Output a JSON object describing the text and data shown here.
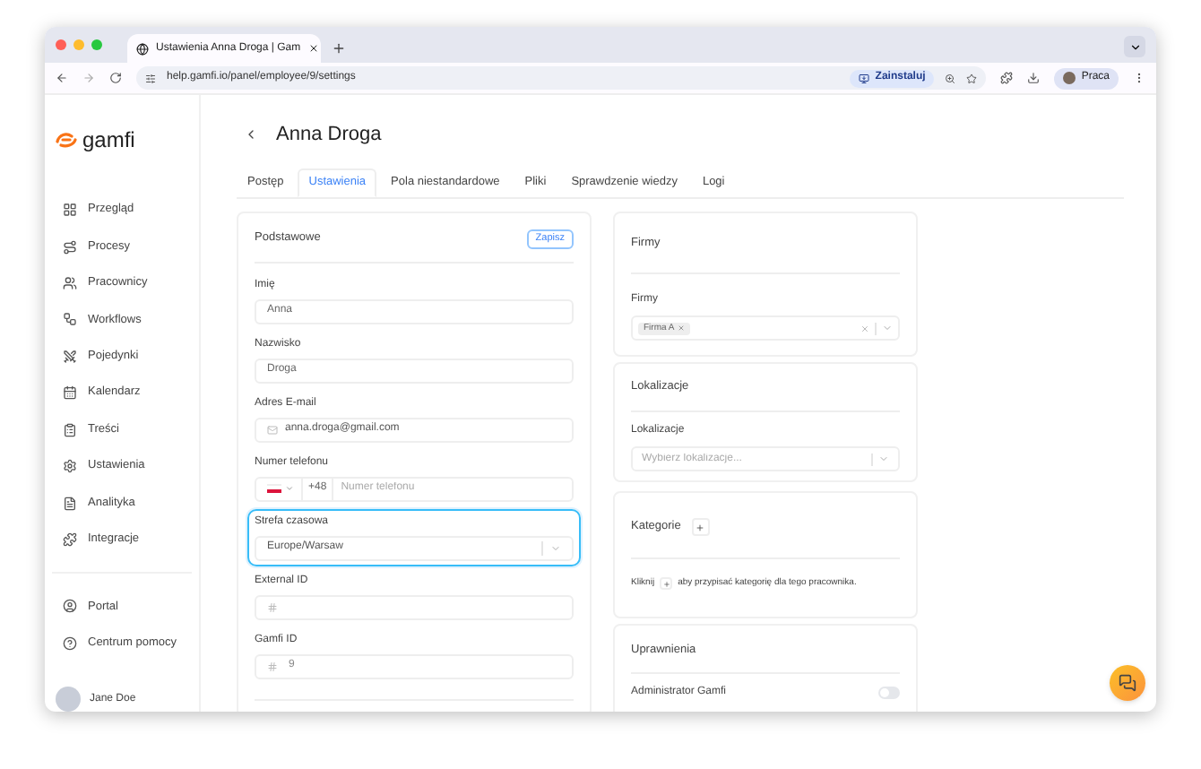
{
  "browser": {
    "tab_title": "Ustawienia Anna Droga | Gam",
    "url": "help.gamfi.io/panel/employee/9/settings",
    "install_label": "Zainstaluj",
    "profile_label": "Praca"
  },
  "sidebar": {
    "logo": "gamfi",
    "items": [
      {
        "label": "Przegląd"
      },
      {
        "label": "Procesy"
      },
      {
        "label": "Pracownicy"
      },
      {
        "label": "Workflows"
      },
      {
        "label": "Pojedynki"
      },
      {
        "label": "Kalendarz"
      },
      {
        "label": "Treści"
      },
      {
        "label": "Ustawienia"
      },
      {
        "label": "Analityka"
      },
      {
        "label": "Integracje"
      }
    ],
    "footer_items": [
      {
        "label": "Portal"
      },
      {
        "label": "Centrum pomocy"
      }
    ],
    "user": "Jane Doe"
  },
  "page": {
    "title": "Anna Droga",
    "tabs": [
      {
        "label": "Postęp",
        "selected": false
      },
      {
        "label": "Ustawienia",
        "selected": true
      },
      {
        "label": "Pola niestandardowe",
        "selected": false
      },
      {
        "label": "Pliki",
        "selected": false
      },
      {
        "label": "Sprawdzenie wiedzy",
        "selected": false
      },
      {
        "label": "Logi",
        "selected": false
      }
    ]
  },
  "basic": {
    "title": "Podstawowe",
    "save": "Zapisz",
    "fields": [
      {
        "kind": "text",
        "label": "Imię",
        "value": "Anna",
        "focused": false
      },
      {
        "kind": "text",
        "label": "Nazwisko",
        "value": "Droga",
        "focused": false
      },
      {
        "kind": "email",
        "label": "Adres E-mail",
        "value": "anna.droga@gmail.com",
        "focused": false
      },
      {
        "kind": "phone",
        "label": "Numer telefonu",
        "prefix": "+48",
        "placeholder": "Numer telefonu",
        "focused": false
      },
      {
        "kind": "select",
        "label": "Strefa czasowa",
        "value": "Europe/Warsaw",
        "focused": true
      },
      {
        "kind": "id",
        "label": "External ID",
        "focused": false
      },
      {
        "kind": "id",
        "label": "Gamfi ID",
        "value": "9",
        "focused": false
      }
    ]
  },
  "companies": {
    "title": "Firmy",
    "label": "Firmy",
    "tags": [
      "Firma A"
    ]
  },
  "locations": {
    "title": "Lokalizacje",
    "label": "Lokalizacje",
    "placeholder": "Wybierz lokalizacje..."
  },
  "categories": {
    "title": "Kategorie",
    "hint_before": "Kliknij",
    "hint_after": "aby przypisać kategorię dla tego pracownika."
  },
  "permissions": {
    "title": "Uprawnienia",
    "toggles": [
      {
        "label": "Administrator Gamfi",
        "on": false
      }
    ]
  }
}
